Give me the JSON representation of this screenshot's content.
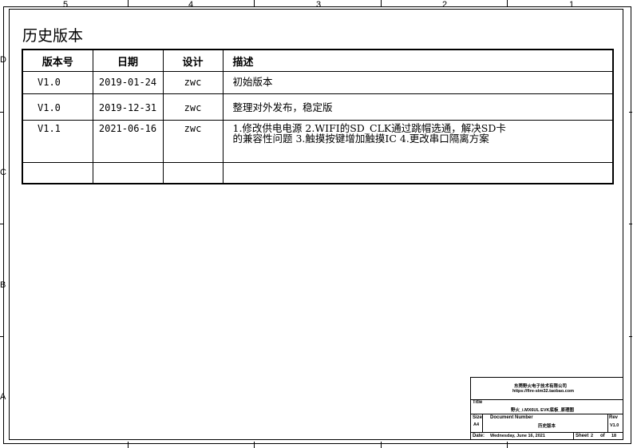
{
  "zones_top": [
    "5",
    "4",
    "3",
    "2",
    "1"
  ],
  "zones_left": [
    "D",
    "C",
    "B",
    "A"
  ],
  "page_title": "历史版本",
  "table": {
    "headers": [
      "版本号",
      "日期",
      "设计",
      "描述"
    ],
    "rows": [
      {
        "version": "V1.0",
        "date": "2019-01-24",
        "designer": "zwc",
        "desc1": "初始版本",
        "desc2": ""
      },
      {
        "version": "V1.0",
        "date": "2019-12-31",
        "designer": "zwc",
        "desc1": "整理对外发布，稳定版",
        "desc2": ""
      },
      {
        "version": "V1.1",
        "date": "2021-06-16",
        "designer": "zwc",
        "desc1": "1.修改供电电源 2.WIFI的SD_CLK通过跳帽选通，解决SD卡",
        "desc2": "的兼容性问题 3.触摸按键增加触摸IC 4.更改串口隔离方案"
      },
      {
        "version": "",
        "date": "",
        "designer": "",
        "desc1": "",
        "desc2": ""
      }
    ]
  },
  "title_block": {
    "company": "东莞野火电子技术有限公司",
    "url": "https://fire-stm32.taobao.com",
    "title_label": "Title",
    "title_value": "野火_i.MX6UL EVK底板_原理图",
    "size_label": "Size",
    "size_value": "A4",
    "docnum_label": "Document Number",
    "docnum_value": "历史版本",
    "rev_label": "Rev",
    "rev_value": "V1.0",
    "date_label": "Date:",
    "date_value": "Wednesday, June 16, 2021",
    "sheet_label": "Sheet",
    "sheet_value": "2",
    "of_label": "of",
    "of_value": "18"
  }
}
